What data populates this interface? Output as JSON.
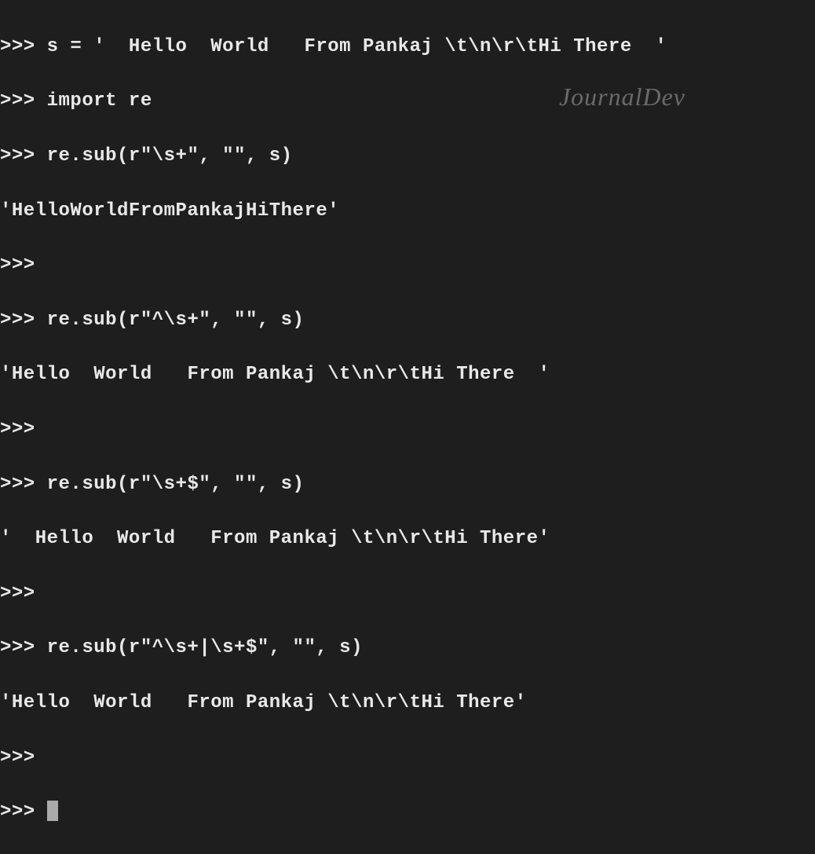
{
  "terminal": {
    "lines": [
      ">>> s = '  Hello  World   From Pankaj \\t\\n\\r\\tHi There  '",
      ">>> import re",
      ">>> re.sub(r\"\\s+\", \"\", s)",
      "'HelloWorldFromPankajHiThere'",
      ">>> ",
      ">>> re.sub(r\"^\\s+\", \"\", s)",
      "'Hello  World   From Pankaj \\t\\n\\r\\tHi There  '",
      ">>> ",
      ">>> re.sub(r\"\\s+$\", \"\", s)",
      "'  Hello  World   From Pankaj \\t\\n\\r\\tHi There'",
      ">>> ",
      ">>> re.sub(r\"^\\s+|\\s+$\", \"\", s)",
      "'Hello  World   From Pankaj \\t\\n\\r\\tHi There'",
      ">>> ",
      ">>> "
    ],
    "prompt": ">>> "
  },
  "watermark": "JournalDev",
  "chart_data": {
    "type": "terminal",
    "language": "python",
    "session": [
      {
        "input": "s = '  Hello  World   From Pankaj \\t\\n\\r\\tHi There  '",
        "output": null
      },
      {
        "input": "import re",
        "output": null
      },
      {
        "input": "re.sub(r\"\\s+\", \"\", s)",
        "output": "'HelloWorldFromPankajHiThere'"
      },
      {
        "input": "re.sub(r\"^\\s+\", \"\", s)",
        "output": "'Hello  World   From Pankaj \\t\\n\\r\\tHi There  '"
      },
      {
        "input": "re.sub(r\"\\s+$\", \"\", s)",
        "output": "'  Hello  World   From Pankaj \\t\\n\\r\\tHi There'"
      },
      {
        "input": "re.sub(r\"^\\s+|\\s+$\", \"\", s)",
        "output": "'Hello  World   From Pankaj \\t\\n\\r\\tHi There'"
      }
    ]
  }
}
